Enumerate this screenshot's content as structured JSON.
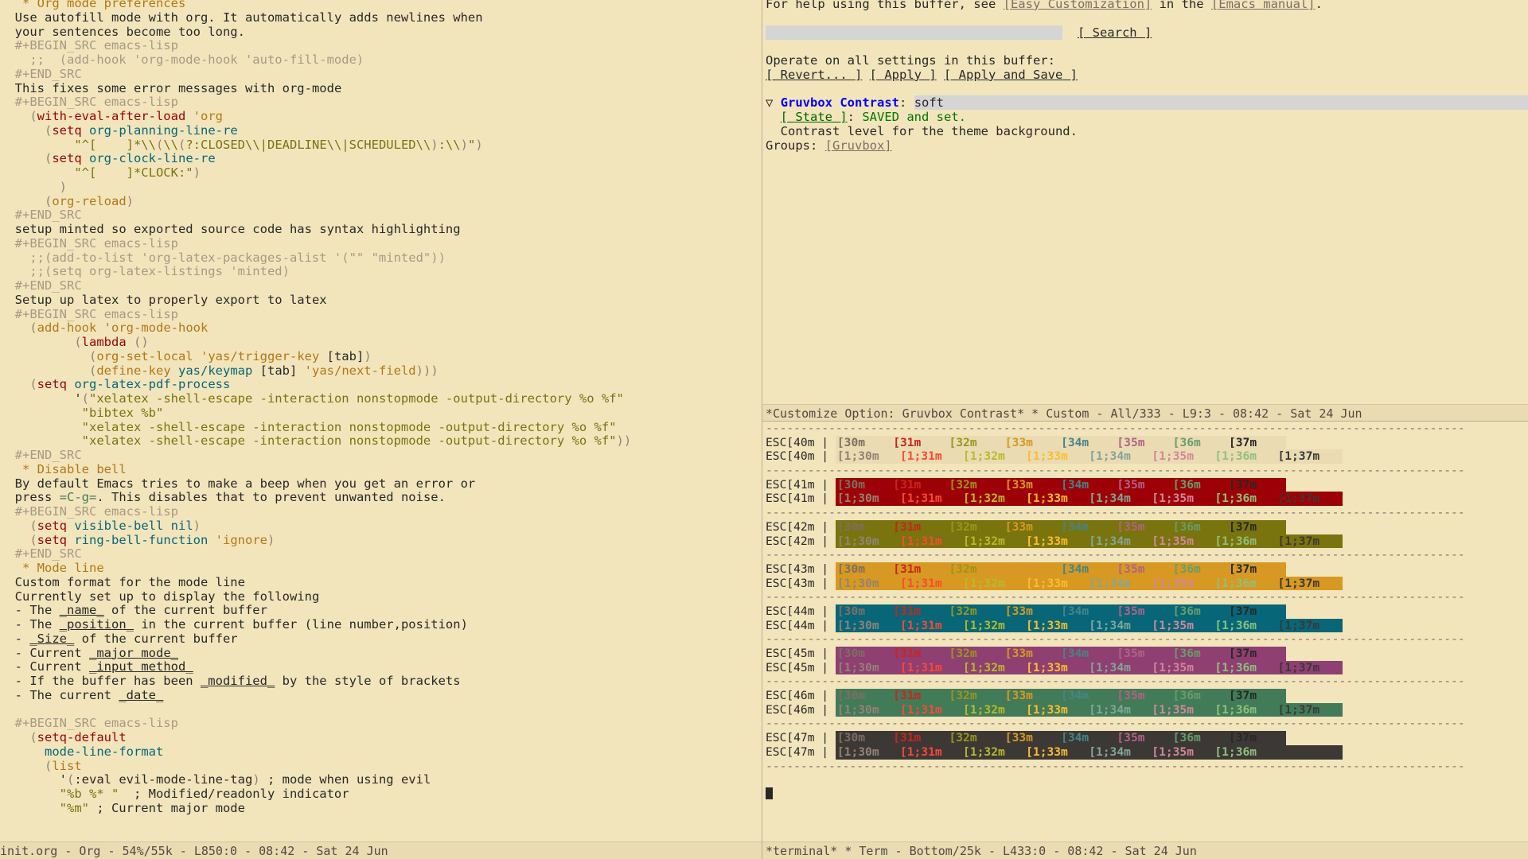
{
  "theme": {
    "background": "#f2e5bc",
    "foreground": "#282828",
    "modeline_bg": "#ebdbb2",
    "modeline_fg": "#504945",
    "heading": "#b57614",
    "keyword": "#9d0006",
    "variable": "#076678",
    "string": "#79740e",
    "comment": "#a89984"
  },
  "left_window": {
    "buffer_name": "init.org",
    "modeline": "init.org - Org - 54%/55k - L850:0 - 08:42 - Sat 24 Jun",
    "lines": [
      {
        "t": "heading",
        "stars": "***",
        "text": "* Org mode preferences"
      },
      {
        "t": "body",
        "text": "Use autofill mode with org. It automatically adds newlines when"
      },
      {
        "t": "body",
        "text": "your sentences become too long."
      },
      {
        "t": "meta",
        "text": "#+BEGIN_SRC emacs-lisp"
      },
      {
        "t": "comment",
        "text": ";;  (add-hook 'org-mode-hook 'auto-fill-mode)"
      },
      {
        "t": "meta",
        "text": "#+END_SRC"
      },
      {
        "t": "body",
        "text": "This fixes some error messages with org-mode"
      },
      {
        "t": "meta",
        "text": "#+BEGIN_SRC emacs-lisp"
      },
      {
        "t": "code",
        "text": "(with-eval-after-load 'org"
      },
      {
        "t": "code",
        "text": "(setq org-planning-line-re"
      },
      {
        "t": "code",
        "text": "\"^[\t ]*\\\\(\\\\(?:CLOSED\\\\|DEADLINE\\\\|SCHEDULED\\\\):\\\\)\")"
      },
      {
        "t": "code",
        "text": "(setq org-clock-line-re"
      },
      {
        "t": "code",
        "text": "\"^[\t ]*CLOCK:\")"
      },
      {
        "t": "code",
        "text": ")"
      },
      {
        "t": "code",
        "text": "(org-reload)"
      },
      {
        "t": "meta",
        "text": "#+END_SRC"
      },
      {
        "t": "body",
        "text": "setup minted so exported source code has syntax highlighting"
      },
      {
        "t": "meta",
        "text": "#+BEGIN_SRC emacs-lisp"
      },
      {
        "t": "comment",
        "text": ";;(add-to-list 'org-latex-packages-alist '(\"\" \"minted\"))"
      },
      {
        "t": "comment",
        "text": ";;(setq org-latex-listings 'minted)"
      },
      {
        "t": "meta",
        "text": "#+END_SRC"
      },
      {
        "t": "body",
        "text": "Setup up latex to properly export to latex"
      },
      {
        "t": "meta",
        "text": "#+BEGIN_SRC emacs-lisp"
      },
      {
        "t": "code",
        "text": "(add-hook 'org-mode-hook"
      },
      {
        "t": "code",
        "text": "(lambda ()"
      },
      {
        "t": "code",
        "text": "(org-set-local 'yas/trigger-key [tab])"
      },
      {
        "t": "code",
        "text": "(define-key yas/keymap [tab] 'yas/next-field)))"
      },
      {
        "t": "code",
        "text": "(setq org-latex-pdf-process"
      },
      {
        "t": "code",
        "text": "'(\"xelatex -shell-escape -interaction nonstopmode -output-directory %o %f\""
      },
      {
        "t": "code",
        "text": "\"bibtex %b\""
      },
      {
        "t": "code",
        "text": "\"xelatex -shell-escape -interaction nonstopmode -output-directory %o %f\""
      },
      {
        "t": "code",
        "text": "\"xelatex -shell-escape -interaction nonstopmode -output-directory %o %f\"))"
      },
      {
        "t": "meta",
        "text": "#+END_SRC"
      },
      {
        "t": "heading",
        "stars": "***",
        "text": "* Disable bell"
      },
      {
        "t": "body",
        "text": "By default Emacs tries to make a beep when you get an error or"
      },
      {
        "t": "body",
        "text": "press =C-g=. This disables that to prevent unwanted noise."
      },
      {
        "t": "meta",
        "text": "#+BEGIN_SRC emacs-lisp"
      },
      {
        "t": "code",
        "text": "(setq visible-bell nil)"
      },
      {
        "t": "code",
        "text": "(setq ring-bell-function 'ignore)"
      },
      {
        "t": "meta",
        "text": "#+END_SRC"
      },
      {
        "t": "heading",
        "stars": "***",
        "text": "* Mode line"
      },
      {
        "t": "body",
        "text": "Custom format for the mode line"
      },
      {
        "t": "body",
        "text": "Currently set up to display the following"
      },
      {
        "t": "body",
        "text": "- The _name_ of the current buffer"
      },
      {
        "t": "body",
        "text": "- The _position_ in the current buffer (line number,position)"
      },
      {
        "t": "body",
        "text": "- _Size_ of the current buffer"
      },
      {
        "t": "body",
        "text": "- Current _major mode_"
      },
      {
        "t": "body",
        "text": "- Current _input method_"
      },
      {
        "t": "body",
        "text": "- If the buffer has been _modified_ by the style of brackets"
      },
      {
        "t": "body",
        "text": "- The current _date_"
      },
      {
        "t": "blank",
        "text": ""
      },
      {
        "t": "meta",
        "text": "#+BEGIN_SRC emacs-lisp"
      },
      {
        "t": "code",
        "text": "(setq-default"
      },
      {
        "t": "code",
        "text": "mode-line-format"
      },
      {
        "t": "code",
        "text": "(list"
      },
      {
        "t": "code",
        "text": "'(:eval evil-mode-line-tag) ; mode when using evil"
      },
      {
        "t": "code",
        "text": "\"%b %* \"  ; Modified/readonly indicator"
      },
      {
        "t": "code",
        "text": "\"%m\" ; Current major mode"
      }
    ]
  },
  "customize_window": {
    "modeline": "*Customize Option: Gruvbox Contrast* * Custom - All/333 - L9:3 - 08:42 - Sat 24 Jun",
    "help_line": {
      "pre": "For help using this buffer, see ",
      "link1": "[Easy Customization]",
      "mid": " in the ",
      "link2": "[Emacs manual]",
      "post": "."
    },
    "search_field_value": "",
    "search_button": "[ Search ]",
    "operate_label": "Operate on all settings in this buffer:",
    "buttons": [
      "[ Revert... ]",
      "[ Apply ]",
      "[ Apply and Save ]"
    ],
    "option": {
      "arrow_icon": "▽",
      "name": "Gruvbox Contrast",
      "separator": ":",
      "value": "soft",
      "state_button": "[ State ]",
      "state_sep": ": ",
      "state_value": "SAVED and set.",
      "doc": "Contrast level for the theme background.",
      "groups_label": "Groups: ",
      "groups_link": "[Gruvbox]"
    }
  },
  "terminal_window": {
    "modeline": "*terminal* * Term - Bottom/25k - L433:0 - 08:42 - Sat 24 Jun",
    "divider": "----------------------------------------------------------------------------------------------------",
    "col_labels": [
      "[30m",
      "[31m",
      "[32m",
      "[33m",
      "[34m",
      "[35m",
      "[36m",
      "[37m"
    ],
    "col_labels_bold": [
      "[1;30m",
      "[1;31m",
      "[1;32m",
      "[1;33m",
      "[1;34m",
      "[1;35m",
      "[1;36m",
      "[1;37m"
    ],
    "fg_colors": [
      "#7c6f64",
      "#cc241d",
      "#98971a",
      "#d79921",
      "#458588",
      "#b16286",
      "#689d6a",
      "#282828"
    ],
    "fg_colors_bold": [
      "#928374",
      "#fb4934",
      "#b8bb26",
      "#fabd2f",
      "#83a598",
      "#d3869b",
      "#8ec07c",
      "#3c3836"
    ],
    "rows": [
      {
        "label": "ESC[40m",
        "bg": "#ebdbb2",
        "bg_bold": "#ebdbb2"
      },
      {
        "label": "ESC[41m",
        "bg": "#9d0006",
        "bg_bold": "#9d0006"
      },
      {
        "label": "ESC[42m",
        "bg": "#79740e",
        "bg_bold": "#79740e"
      },
      {
        "label": "ESC[43m",
        "bg": "#d79921",
        "bg_bold": "#d79921"
      },
      {
        "label": "ESC[44m",
        "bg": "#076678",
        "bg_bold": "#076678"
      },
      {
        "label": "ESC[45m",
        "bg": "#8f3f71",
        "bg_bold": "#8f3f71"
      },
      {
        "label": "ESC[46m",
        "bg": "#427b58",
        "bg_bold": "#427b58"
      },
      {
        "label": "ESC[47m",
        "bg": "#3c3836",
        "bg_bold": "#3c3836"
      }
    ],
    "pipe": "|",
    "prompt_cursor": "_"
  }
}
